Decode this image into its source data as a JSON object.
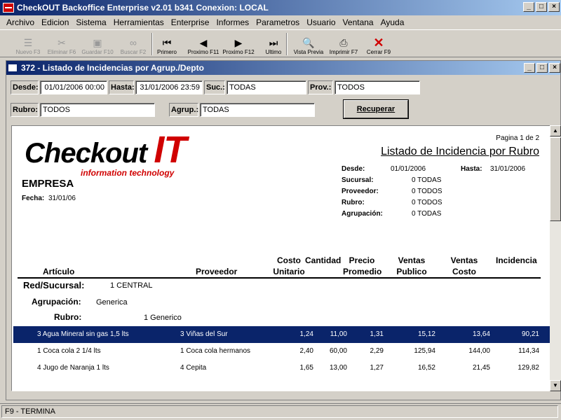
{
  "app": {
    "title": "CheckOUT Backoffice Enterprise v2.01 b341 Conexion: LOCAL",
    "buttons": {
      "minimize": "_",
      "maximize": "□",
      "close": "×"
    }
  },
  "menu": [
    "Archivo",
    "Edicion",
    "Sistema",
    "Herramientas",
    "Enterprise",
    "Informes",
    "Parametros",
    "Usuario",
    "Ventana",
    "Ayuda"
  ],
  "toolbar": {
    "nuevo": "Nuevo F3",
    "eliminar": "Eliminar F6",
    "guardar": "Guardar F10",
    "buscar": "Buscar F2",
    "primero": "Primero",
    "proximo_f11": "Proximo F11",
    "proximo_f12": "Proximo F12",
    "ultimo": "Ultimo",
    "vista": "Vista Previa",
    "imprimir": "Imprimir F7",
    "cerrar": "Cerrar F9",
    "icons": {
      "nuevo": "new-icon",
      "eliminar": "delete-icon",
      "guardar": "save-icon",
      "buscar": "binoculars-icon",
      "primero": "first-record-icon",
      "proximo_f11": "prev-record-icon",
      "proximo_f12": "next-record-icon",
      "ultimo": "last-record-icon",
      "vista": "print-preview-icon",
      "imprimir": "printer-icon",
      "cerrar": "close-x-icon"
    }
  },
  "child": {
    "title": "372 - Listado de Incidencias por Agrup./Depto",
    "filters": {
      "desde_label": "Desde:",
      "desde_value": "01/01/2006 00:00",
      "hasta_label": "Hasta:",
      "hasta_value": "31/01/2006 23:59",
      "suc_label": "Suc.:",
      "suc_value": "TODAS",
      "prov_label": "Prov.:",
      "prov_value": "TODOS",
      "rubro_label": "Rubro:",
      "rubro_value": "TODOS",
      "agrup_label": "Agrup.:",
      "agrup_value": "TODAS",
      "recuperar": "Recuperar"
    }
  },
  "report": {
    "logo_main": "Checkout",
    "logo_it": "IT",
    "logo_sub": "information technology",
    "page": "Pagina 1 de 2",
    "title": "Listado de Incidencia por Rubro",
    "empresa": "EMPRESA",
    "fecha_label": "Fecha:",
    "fecha_value": "31/01/06",
    "desde_label": "Desde:",
    "desde_value": "01/01/2006",
    "hasta_label": "Hasta:",
    "hasta_value": "31/01/2006",
    "sucursal_label": "Sucursal:",
    "sucursal_value": "0 TODAS",
    "proveedor_label": "Proveedor:",
    "proveedor_value": "0 TODOS",
    "rubro_label": "Rubro:",
    "rubro_value": "0 TODOS",
    "agrupacion_label": "Agrupación:",
    "agrupacion_value": "0 TODAS",
    "columns": {
      "articulo": "Artículo",
      "proveedor": "Proveedor",
      "costo_1": "Costo",
      "costo_2": "Unitario",
      "cantidad": "Cantidad",
      "precio_1": "Precio",
      "precio_2": "Promedio",
      "ventas_pub_1": "Ventas",
      "ventas_pub_2": "Publico",
      "ventas_costo_1": "Ventas",
      "ventas_costo_2": "Costo",
      "incidencia": "Incidencia"
    },
    "group": {
      "red_label": "Red/Sucursal:",
      "red_value": "1  CENTRAL",
      "agrup_label": "Agrupación:",
      "agrup_value": "Generica",
      "rubro_label": "Rubro:",
      "rubro_value": "1 Generico"
    },
    "rows": [
      {
        "articulo": "3 Agua Mineral sin gas 1,5 lts",
        "proveedor": "3 Viñas del Sur",
        "costo": "1,24",
        "cantidad": "11,00",
        "precio": "1,31",
        "ventas_publico": "15,12",
        "ventas_costo": "13,64",
        "incidencia": "90,21"
      },
      {
        "articulo": "1 Coca cola 2 1/4 lts",
        "proveedor": "1 Coca cola hermanos",
        "costo": "2,40",
        "cantidad": "60,00",
        "precio": "2,29",
        "ventas_publico": "125,94",
        "ventas_costo": "144,00",
        "incidencia": "114,34"
      },
      {
        "articulo": "4 Jugo de Naranja 1 lts",
        "proveedor": "4 Cepita",
        "costo": "1,65",
        "cantidad": "13,00",
        "precio": "1,27",
        "ventas_publico": "16,52",
        "ventas_costo": "21,45",
        "incidencia": "129,82"
      }
    ]
  },
  "status": {
    "text": "F9 - TERMINA"
  },
  "colors": {
    "titlebar": "#0a246a",
    "logo_red": "#d00000",
    "selected_row": "#0a246a"
  }
}
